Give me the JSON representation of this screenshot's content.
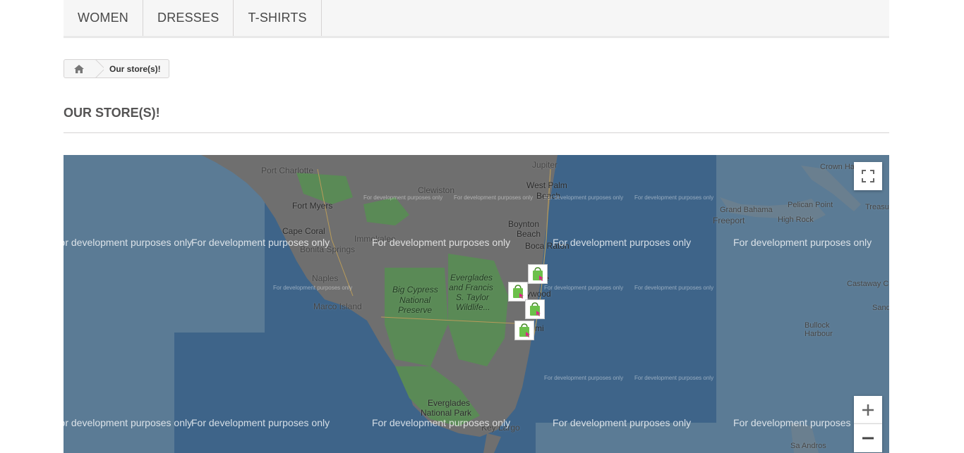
{
  "nav": {
    "items": [
      {
        "label": "WOMEN"
      },
      {
        "label": "DRESSES"
      },
      {
        "label": "T-SHIRTS"
      }
    ]
  },
  "breadcrumb": {
    "home_icon": "home-icon",
    "current": "Our store(s)!"
  },
  "page": {
    "title": "OUR STORE(S)!"
  },
  "map": {
    "watermark": "For development purposes only",
    "markers_count": 4,
    "place_labels": [
      "Port Charlotte",
      "Clewiston",
      "Jupiter",
      "West Palm",
      "Beach",
      "Fort Myers",
      "Cape Coral",
      "Bonita Springs",
      "Immokalee",
      "Boynton",
      "Beach",
      "Boca Raton",
      "Naples",
      "Marco Island",
      "Big Cypress",
      "National",
      "Preserve",
      "Everglades",
      "and Francis",
      "S. Taylor",
      "Wildlife...",
      "Everglades",
      "National Park",
      "Key Largo",
      "Crown Haven",
      "Grand Bahama",
      "Pelican Point",
      "Treasure",
      "Freeport",
      "High Rock",
      "Castaway C",
      "Sand",
      "Bullock",
      "Harbour",
      "Sa Andros",
      "ale",
      "ywood",
      "mi"
    ],
    "colors": {
      "water": "#3e6489",
      "land": "#6f6f6f",
      "park": "#5a8a56",
      "overlay_light": "#5d7d97"
    }
  },
  "controls": {
    "fullscreen_icon": "fullscreen-icon",
    "zoom_in_icon": "plus-icon",
    "zoom_out_icon": "minus-icon"
  }
}
